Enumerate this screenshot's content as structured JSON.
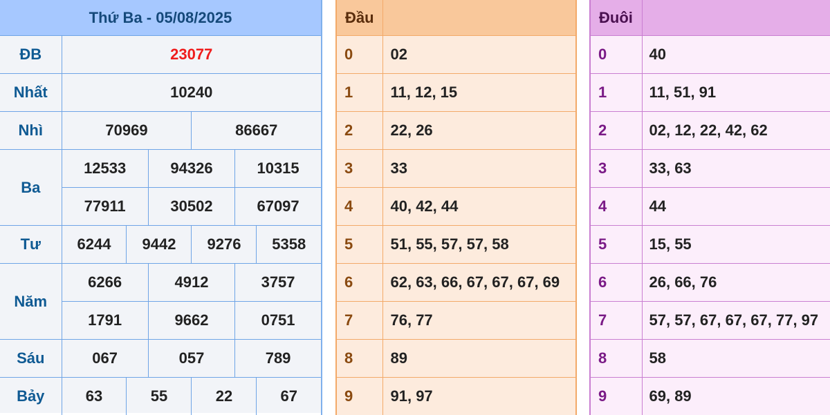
{
  "results": {
    "title": "Thứ Ba - 05/08/2025",
    "prizes": [
      {
        "label": "ĐB",
        "numbers": [
          "23077"
        ]
      },
      {
        "label": "Nhất",
        "numbers": [
          "10240"
        ]
      },
      {
        "label": "Nhì",
        "numbers": [
          "70969",
          "86667"
        ]
      },
      {
        "label": "Ba",
        "numbers": [
          "12533",
          "94326",
          "10315",
          "77911",
          "30502",
          "67097"
        ]
      },
      {
        "label": "Tư",
        "numbers": [
          "6244",
          "9442",
          "9276",
          "5358"
        ]
      },
      {
        "label": "Năm",
        "numbers": [
          "6266",
          "4912",
          "3757",
          "1791",
          "9662",
          "0751"
        ]
      },
      {
        "label": "Sáu",
        "numbers": [
          "067",
          "057",
          "789"
        ]
      },
      {
        "label": "Bảy",
        "numbers": [
          "63",
          "55",
          "22",
          "67"
        ]
      }
    ]
  },
  "dau": {
    "header": "Đầu",
    "rows": [
      {
        "key": "0",
        "value": "02"
      },
      {
        "key": "1",
        "value": "11, 12, 15"
      },
      {
        "key": "2",
        "value": "22, 26"
      },
      {
        "key": "3",
        "value": "33"
      },
      {
        "key": "4",
        "value": "40, 42, 44"
      },
      {
        "key": "5",
        "value": "51, 55, 57, 57, 58"
      },
      {
        "key": "6",
        "value": "62, 63, 66, 67, 67, 67, 69"
      },
      {
        "key": "7",
        "value": "76, 77"
      },
      {
        "key": "8",
        "value": "89"
      },
      {
        "key": "9",
        "value": "91, 97"
      }
    ]
  },
  "duoi": {
    "header": "Đuôi",
    "rows": [
      {
        "key": "0",
        "value": "40"
      },
      {
        "key": "1",
        "value": "11, 51, 91"
      },
      {
        "key": "2",
        "value": "02, 12, 22, 42, 62"
      },
      {
        "key": "3",
        "value": "33, 63"
      },
      {
        "key": "4",
        "value": "44"
      },
      {
        "key": "5",
        "value": "15, 55"
      },
      {
        "key": "6",
        "value": "26, 66, 76"
      },
      {
        "key": "7",
        "value": "57, 57, 67, 67, 67, 77, 97"
      },
      {
        "key": "8",
        "value": "58"
      },
      {
        "key": "9",
        "value": "69, 89"
      }
    ]
  }
}
